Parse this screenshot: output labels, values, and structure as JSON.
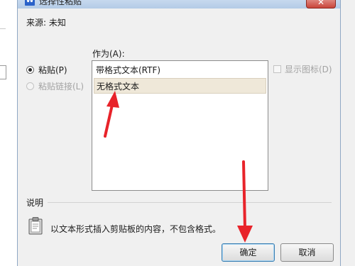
{
  "window": {
    "title": "选择性粘贴",
    "title_icon": "W",
    "close_glyph": "✕"
  },
  "source": {
    "label": "来源: 未知"
  },
  "as_label": "作为(A):",
  "options": {
    "paste": "粘贴(P)",
    "paste_link": "粘贴链接(L)"
  },
  "formats": [
    "带格式文本(RTF)",
    "无格式文本"
  ],
  "selected_format": "无格式文本",
  "show_as_icon": "显示图标(D)",
  "description": {
    "label": "说明",
    "text": "以文本形式插入剪贴板的内容，不包含格式。"
  },
  "buttons": {
    "ok": "确定",
    "cancel": "取消"
  },
  "colors": {
    "annotation_arrow": "#e8232a",
    "selection": "#efe8d9",
    "title_bar": "#c7d9ee"
  }
}
